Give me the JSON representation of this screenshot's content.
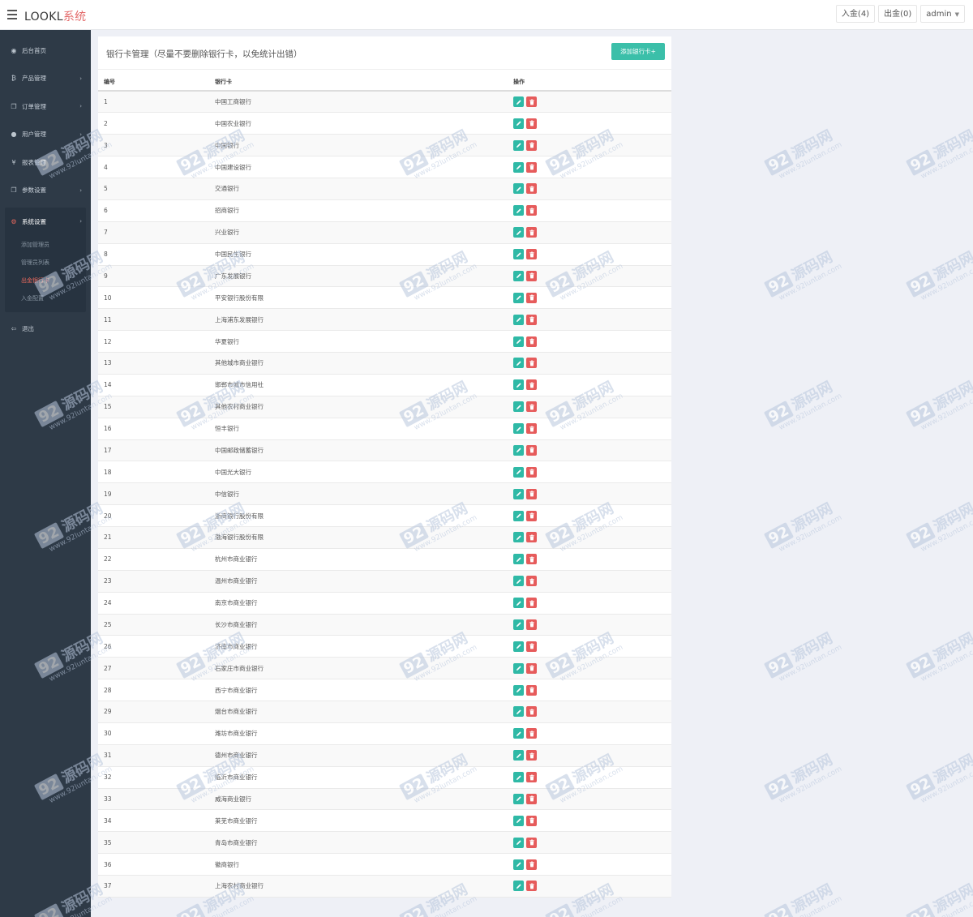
{
  "header": {
    "brand_prefix": "LOOKL",
    "brand_suffix": "系统",
    "deposit_label": "入金(4)",
    "withdraw_label": "出金(0)",
    "user_label": "admin"
  },
  "sidebar": {
    "items": [
      {
        "label": "后台首页",
        "icon": "dashboard-icon",
        "glyph": "◉"
      },
      {
        "label": "产品管理",
        "icon": "bitcoin-icon",
        "glyph": "₿"
      },
      {
        "label": "订单管理",
        "icon": "copy-icon",
        "glyph": "❐"
      },
      {
        "label": "用户管理",
        "icon": "user-icon",
        "glyph": "●"
      },
      {
        "label": "报表管理",
        "icon": "yen-icon",
        "glyph": "¥"
      },
      {
        "label": "参数设置",
        "icon": "copy-icon",
        "glyph": "❐"
      }
    ],
    "active_group": {
      "label": "系统设置",
      "icon": "cogs-icon",
      "glyph": "⚙",
      "children": [
        "添加管理员",
        "管理员列表",
        "出金银行卡",
        "入金配置"
      ],
      "active_child_index": 2
    },
    "logout": {
      "label": "退出",
      "icon": "sign-out-icon",
      "glyph": "⇦"
    }
  },
  "main": {
    "title": "银行卡管理（尽量不要删除银行卡，以免统计出错）",
    "add_button": "添加银行卡+",
    "columns": [
      "编号",
      "银行卡",
      "操作"
    ],
    "rows": [
      {
        "id": "1",
        "bank": "中国工商银行"
      },
      {
        "id": "2",
        "bank": "中国农业银行"
      },
      {
        "id": "3",
        "bank": "中国银行"
      },
      {
        "id": "4",
        "bank": "中国建设银行"
      },
      {
        "id": "5",
        "bank": "交通银行"
      },
      {
        "id": "6",
        "bank": "招商银行"
      },
      {
        "id": "7",
        "bank": "兴业银行"
      },
      {
        "id": "8",
        "bank": "中国民生银行"
      },
      {
        "id": "9",
        "bank": "广东发展银行"
      },
      {
        "id": "10",
        "bank": "平安银行股份有限"
      },
      {
        "id": "11",
        "bank": "上海浦东发展银行"
      },
      {
        "id": "12",
        "bank": "华夏银行"
      },
      {
        "id": "13",
        "bank": "其他城市商业银行"
      },
      {
        "id": "14",
        "bank": "邯郸市城市信用社"
      },
      {
        "id": "15",
        "bank": "其他农村商业银行"
      },
      {
        "id": "16",
        "bank": "恒丰银行"
      },
      {
        "id": "17",
        "bank": "中国邮政储蓄银行"
      },
      {
        "id": "18",
        "bank": "中国光大银行"
      },
      {
        "id": "19",
        "bank": "中信银行"
      },
      {
        "id": "20",
        "bank": "浙商银行股份有限"
      },
      {
        "id": "21",
        "bank": "渤海银行股份有限"
      },
      {
        "id": "22",
        "bank": "杭州市商业银行"
      },
      {
        "id": "23",
        "bank": "温州市商业银行"
      },
      {
        "id": "24",
        "bank": "南京市商业银行"
      },
      {
        "id": "25",
        "bank": "长沙市商业银行"
      },
      {
        "id": "26",
        "bank": "济南市商业银行"
      },
      {
        "id": "27",
        "bank": "石家庄市商业银行"
      },
      {
        "id": "28",
        "bank": "西宁市商业银行"
      },
      {
        "id": "29",
        "bank": "烟台市商业银行"
      },
      {
        "id": "30",
        "bank": "潍坊市商业银行"
      },
      {
        "id": "31",
        "bank": "德州市商业银行"
      },
      {
        "id": "32",
        "bank": "临沂市商业银行"
      },
      {
        "id": "33",
        "bank": "威海商业银行"
      },
      {
        "id": "34",
        "bank": "莱芜市商业银行"
      },
      {
        "id": "35",
        "bank": "青岛市商业银行"
      },
      {
        "id": "36",
        "bank": "徽商银行"
      },
      {
        "id": "37",
        "bank": "上海农村商业银行"
      }
    ],
    "actions": {
      "edit_icon": "pencil-icon",
      "delete_icon": "trash-icon"
    }
  },
  "watermark": {
    "badge": "92",
    "name": "源码网",
    "url": "www.92luntan.com"
  },
  "colors": {
    "sidebar_bg": "#2e3a47",
    "accent_red": "#e8685d",
    "accent_teal": "#3bbfa9",
    "delete_red": "#e65b5b",
    "page_bg": "#eef0f6"
  }
}
